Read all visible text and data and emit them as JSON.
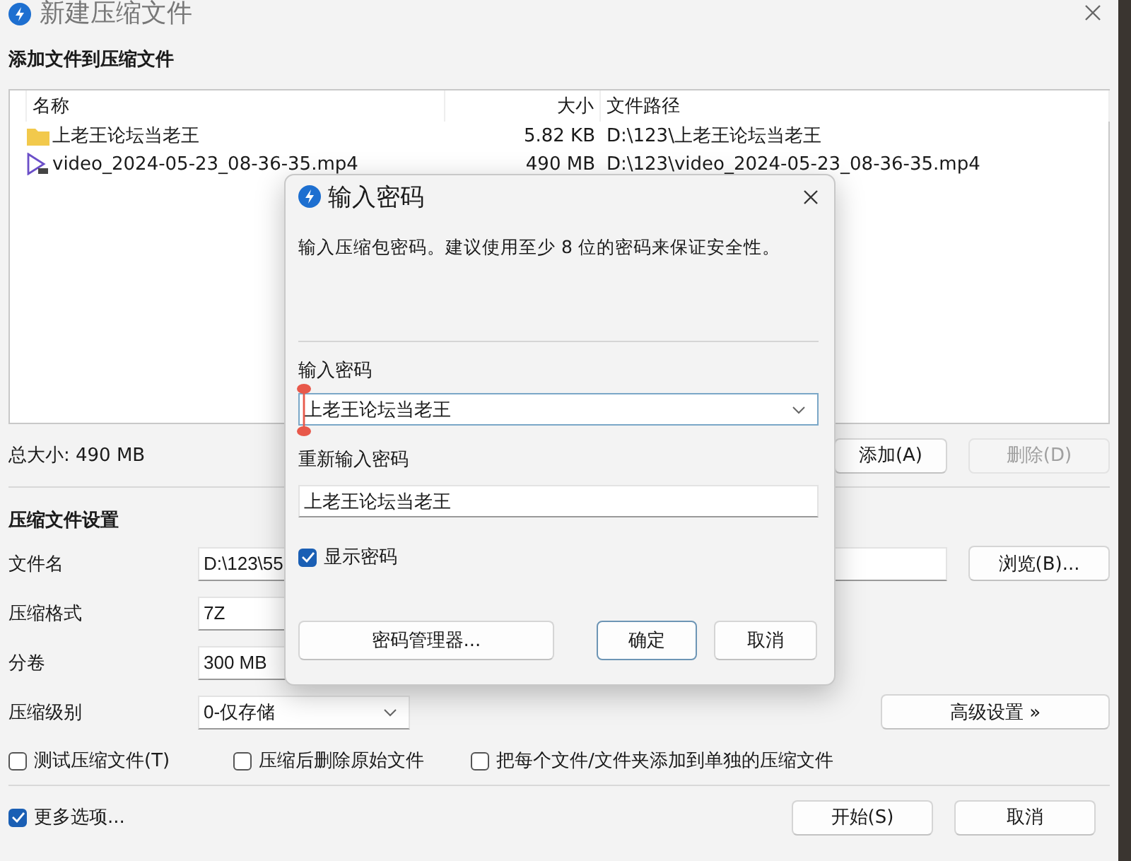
{
  "window": {
    "title": "新建压缩文件"
  },
  "files_section": {
    "heading": "添加文件到压缩文件",
    "columns": [
      "名称",
      "大小",
      "文件路径"
    ],
    "rows": [
      {
        "kind": "folder",
        "name": "上老王论坛当老王",
        "size": "5.82 KB",
        "path": "D:\\123\\上老王论坛当老王"
      },
      {
        "kind": "video",
        "name": "video_2024-05-23_08-36-35.mp4",
        "size": "490 MB",
        "path": "D:\\123\\video_2024-05-23_08-36-35.mp4"
      }
    ],
    "total": "总大小: 490 MB",
    "buttons": [
      {
        "label": "添加(A)",
        "disabled": false
      },
      {
        "label": "删除(D)",
        "disabled": true
      }
    ]
  },
  "settings": {
    "heading": "压缩文件设置",
    "fields": [
      {
        "label": "文件名",
        "value": "D:\\123\\55",
        "kind": "text"
      },
      {
        "label": "压缩格式",
        "value": "7Z",
        "kind": "text"
      },
      {
        "label": "分卷",
        "value": "300 MB",
        "kind": "text"
      },
      {
        "label": "压缩级别",
        "value": "0-仅存储",
        "kind": "dropdown"
      }
    ],
    "browse_button": "浏览(B)...",
    "advanced_button": "高级设置 »",
    "options": [
      {
        "label": "测试压缩文件(T)",
        "checked": false
      },
      {
        "label": "压缩后删除原始文件",
        "checked": false
      },
      {
        "label": "把每个文件/文件夹添加到单独的压缩文件",
        "checked": false
      }
    ]
  },
  "more_options": {
    "label": "更多选项...",
    "checked": true
  },
  "footer_buttons": [
    "开始(S)",
    "取消"
  ],
  "password_dialog": {
    "title": "输入密码",
    "description": "输入压缩包密码。建议使用至少 8 位的密码来保证安全性。",
    "password_label": "输入密码",
    "password": "上老王论坛当老王",
    "confirm_label": "重新输入密码",
    "confirm": "上老王论坛当老王",
    "show_password": {
      "label": "显示密码",
      "checked": true
    },
    "buttons": [
      {
        "label": "密码管理器...",
        "default": false
      },
      {
        "label": "确定",
        "default": true
      },
      {
        "label": "取消",
        "default": false
      }
    ]
  }
}
